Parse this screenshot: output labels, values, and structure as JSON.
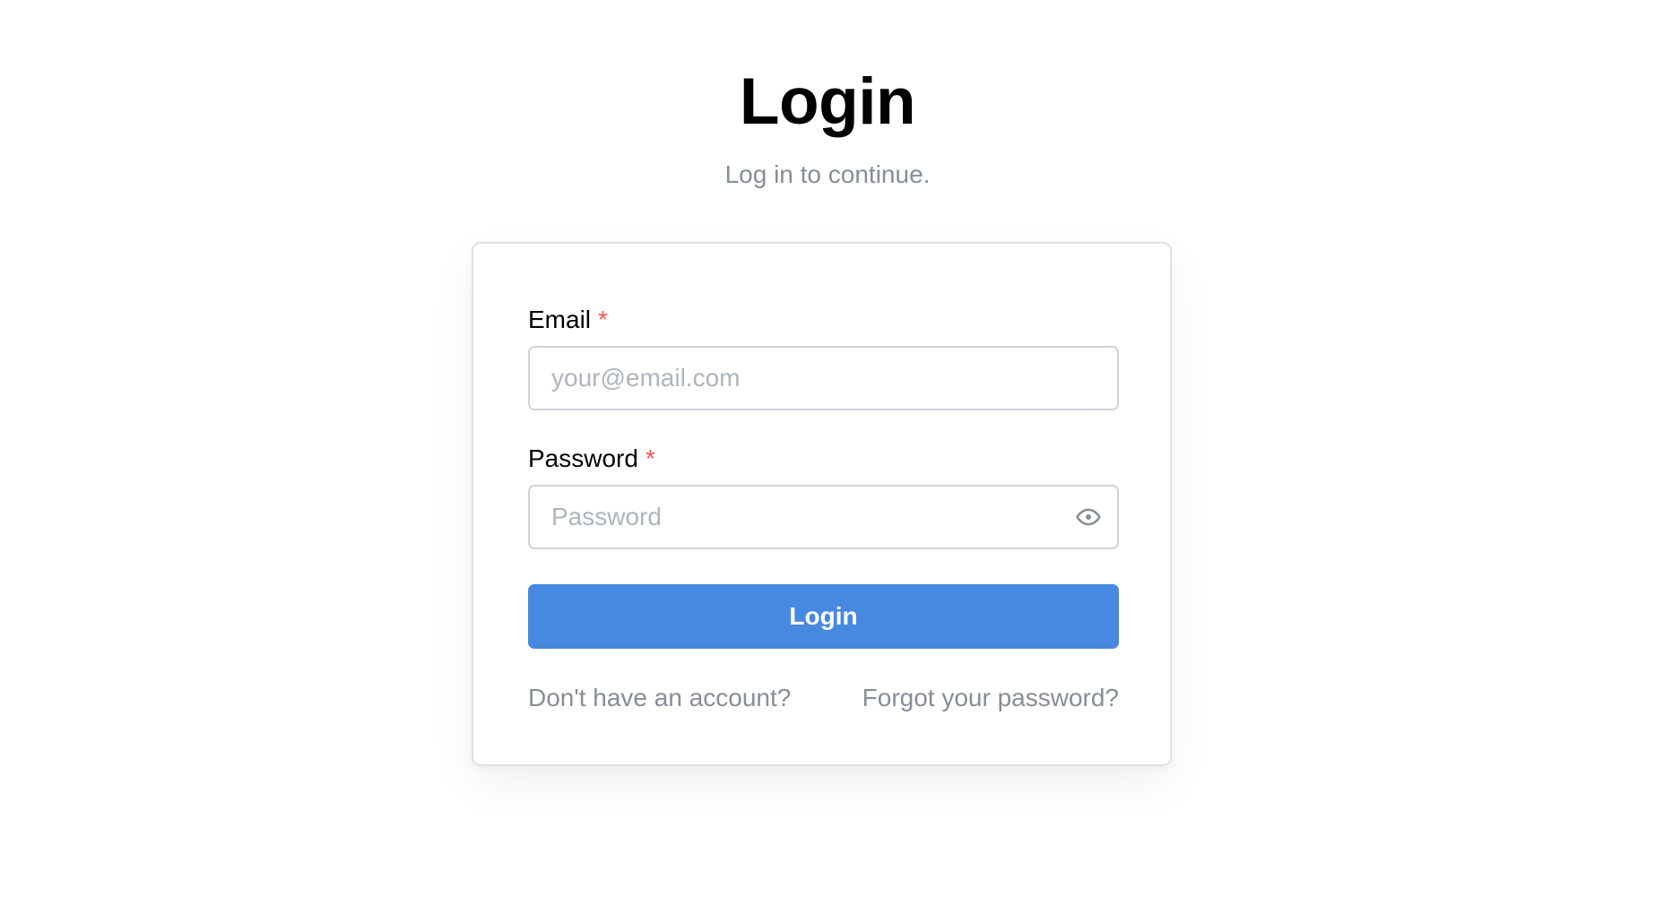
{
  "header": {
    "title": "Login",
    "subtitle": "Log in to continue."
  },
  "form": {
    "email": {
      "label": "Email",
      "required_mark": "*",
      "placeholder": "your@email.com",
      "value": ""
    },
    "password": {
      "label": "Password",
      "required_mark": "*",
      "placeholder": "Password",
      "value": "",
      "toggle_icon": "eye-icon"
    },
    "submit_label": "Login",
    "links": {
      "signup": "Don't have an account?",
      "forgot": "Forgot your password?"
    }
  },
  "colors": {
    "primary": "#4788e0",
    "required": "#fa5252",
    "muted_text": "#868e96",
    "placeholder": "#adb5bd",
    "border": "#ced4da"
  }
}
